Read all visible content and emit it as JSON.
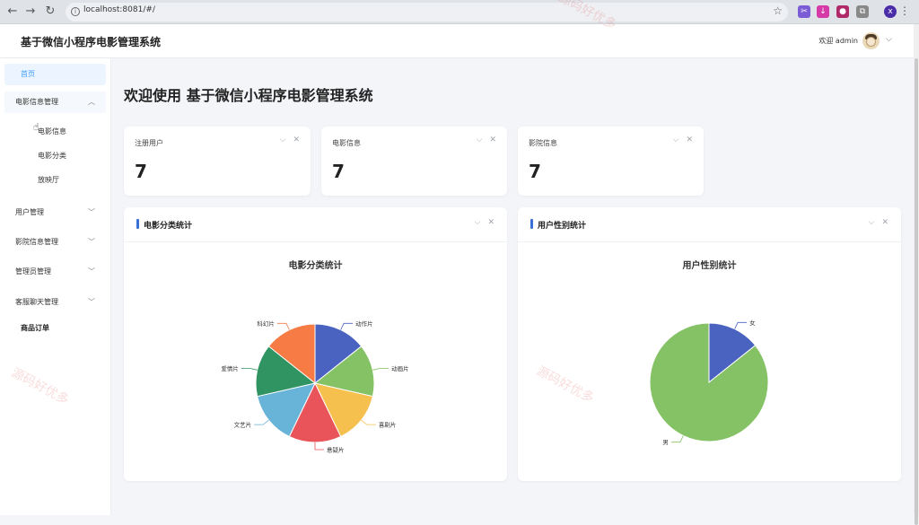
{
  "browser": {
    "url": "localhost:8081/#/"
  },
  "header": {
    "title": "基于微信小程序电影管理系统",
    "welcome": "欢迎 admin"
  },
  "sidebar": {
    "items": [
      {
        "label": "首页"
      },
      {
        "label": "电影信息管理"
      },
      {
        "label": "用户管理"
      },
      {
        "label": "影院信息管理"
      },
      {
        "label": "管理员管理"
      },
      {
        "label": "客服聊天管理"
      }
    ],
    "sub_items": [
      {
        "label": "电影信息"
      },
      {
        "label": "电影分类"
      },
      {
        "label": "放映厅"
      }
    ],
    "plain_item": "商品订单"
  },
  "main": {
    "heading": "欢迎使用 基于微信小程序电影管理系统",
    "stats": [
      {
        "label": "注册用户",
        "value": "7"
      },
      {
        "label": "电影信息",
        "value": "7"
      },
      {
        "label": "影院信息",
        "value": "7"
      }
    ],
    "panels": [
      {
        "title": "电影分类统计",
        "chart_title": "电影分类统计"
      },
      {
        "title": "用户性别统计",
        "chart_title": "用户性别统计"
      }
    ]
  },
  "watermark": "源码好优多",
  "chart_data": [
    {
      "type": "pie",
      "title": "电影分类统计",
      "categories": [
        "动作片",
        "动画片",
        "喜剧片",
        "悬疑片",
        "文艺片",
        "爱情片",
        "科幻片"
      ],
      "values": [
        1,
        1,
        1,
        1,
        1,
        1,
        1
      ],
      "colors": [
        "#4a62c0",
        "#85c265",
        "#f6c04e",
        "#e9545a",
        "#68b3d8",
        "#2f9462",
        "#f77b45"
      ]
    },
    {
      "type": "pie",
      "title": "用户性别统计",
      "categories": [
        "女",
        "男"
      ],
      "values": [
        1,
        6
      ],
      "colors": [
        "#4a62c0",
        "#85c265"
      ]
    }
  ]
}
